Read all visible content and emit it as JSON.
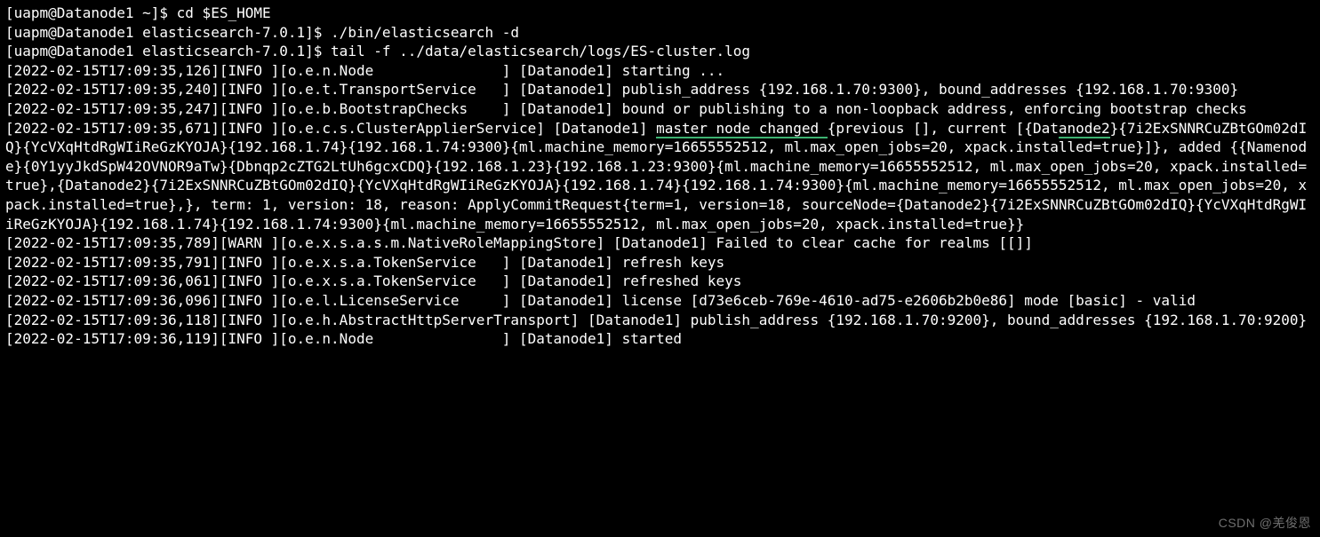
{
  "terminal": {
    "lines": [
      {
        "text": "[uapm@Datanode1 ~]$ cd $ES_HOME"
      },
      {
        "text": "[uapm@Datanode1 elasticsearch-7.0.1]$ ./bin/elasticsearch -d"
      },
      {
        "text": "[uapm@Datanode1 elasticsearch-7.0.1]$ tail -f ../data/elasticsearch/logs/ES-cluster.log"
      },
      {
        "text": "[2022-02-15T17:09:35,126][INFO ][o.e.n.Node               ] [Datanode1] starting ..."
      },
      {
        "text": "[2022-02-15T17:09:35,240][INFO ][o.e.t.TransportService   ] [Datanode1] publish_address {192.168.1.70:9300}, bound_addresses {192.168.1.70:9300}"
      },
      {
        "text": "[2022-02-15T17:09:35,247][INFO ][o.e.b.BootstrapChecks    ] [Datanode1] bound or publishing to a non-loopback address, enforcing bootstrap checks"
      },
      {
        "segments": [
          {
            "text": "[2022-02-15T17:09:35,671][INFO ][o.e.c.s.ClusterApplierService] [Datanode1] "
          },
          {
            "text": "master node changed ",
            "underline": true
          },
          {
            "text": "{previous [], current [{Dat"
          },
          {
            "text": "anode2",
            "underline": true
          },
          {
            "text": "}{7i2ExSNNRCuZBtGOm02dIQ}{YcVXqHtdRgWIiReGzKYOJA}{192.168.1.74}{192.168.1.74:9300}{ml.machine_memory=16655552512, ml.max_open_jobs=20, xpack.installed=true}]}, added {{Namenode}{0Y1yyJkdSpW42OVNOR9aTw}{Dbnqp2cZTG2LtUh6gcxCDQ}{192.168.1.23}{192.168.1.23:9300}{ml.machine_memory=16655552512, ml.max_open_jobs=20, xpack.installed=true},{Datanode2}{7i2ExSNNRCuZBtGOm02dIQ}{YcVXqHtdRgWIiReGzKYOJA}{192.168.1.74}{192.168.1.74:9300}{ml.machine_memory=16655552512, ml.max_open_jobs=20, xpack.installed=true},}, term: 1, version: 18, reason: ApplyCommitRequest{term=1, version=18, sourceNode={Datanode2}{7i2ExSNNRCuZBtGOm02dIQ}{YcVXqHtdRgWIiReGzKYOJA}{192.168.1.74}{192.168.1.74:9300}{ml.machine_memory=16655552512, ml.max_open_jobs=20, xpack.installed=true}}"
          }
        ]
      },
      {
        "text": "[2022-02-15T17:09:35,789][WARN ][o.e.x.s.a.s.m.NativeRoleMappingStore] [Datanode1] Failed to clear cache for realms [[]]"
      },
      {
        "text": "[2022-02-15T17:09:35,791][INFO ][o.e.x.s.a.TokenService   ] [Datanode1] refresh keys"
      },
      {
        "text": "[2022-02-15T17:09:36,061][INFO ][o.e.x.s.a.TokenService   ] [Datanode1] refreshed keys"
      },
      {
        "text": "[2022-02-15T17:09:36,096][INFO ][o.e.l.LicenseService     ] [Datanode1] license [d73e6ceb-769e-4610-ad75-e2606b2b0e86] mode [basic] - valid"
      },
      {
        "text": "[2022-02-15T17:09:36,118][INFO ][o.e.h.AbstractHttpServerTransport] [Datanode1] publish_address {192.168.1.70:9200}, bound_addresses {192.168.1.70:9200}"
      },
      {
        "text": "[2022-02-15T17:09:36,119][INFO ][o.e.n.Node               ] [Datanode1] started"
      }
    ]
  },
  "watermark": "CSDN @羌俊恩"
}
